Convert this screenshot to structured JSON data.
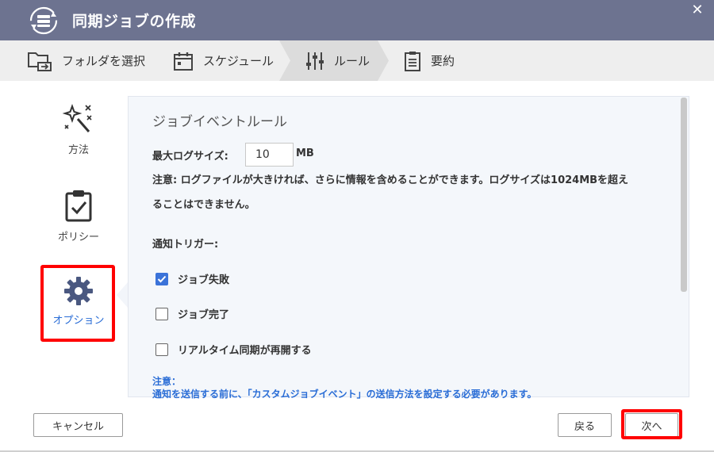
{
  "window": {
    "title": "同期ジョブの作成",
    "close_label": "✕"
  },
  "steps": [
    {
      "label": "フォルダを選択",
      "icon": "folder-sync-icon"
    },
    {
      "label": "スケジュール",
      "icon": "calendar-icon"
    },
    {
      "label": "ルール",
      "icon": "sliders-icon",
      "active": true
    },
    {
      "label": "要約",
      "icon": "clipboard-list-icon"
    }
  ],
  "sidebar": {
    "items": [
      {
        "label": "方法",
        "icon": "magic-wand-icon"
      },
      {
        "label": "ポリシー",
        "icon": "clipboard-check-icon"
      },
      {
        "label": "オプション",
        "icon": "gear-icon",
        "selected": true
      }
    ]
  },
  "main": {
    "section_title": "ジョブイベントルール",
    "log_size_label": "最大ログサイズ:",
    "log_size_value": "10",
    "log_size_unit": "MB",
    "note_line1": "注意: ログファイルが大きければ、さらに情報を含めることができます。ログサイズは1024MBを超え",
    "note_line2": "ることはできません。",
    "trigger_label": "通知トリガー:",
    "triggers": [
      {
        "label": "ジョブ失敗",
        "checked": true
      },
      {
        "label": "ジョブ完了",
        "checked": false
      },
      {
        "label": "リアルタイム同期が再開する",
        "checked": false
      }
    ],
    "notice_title": "注意：",
    "notice_text": "通知を送信する前に、「カスタムジョブイベント」の送信方法を設定する必要があります。"
  },
  "footer": {
    "cancel_label": "キャンセル",
    "back_label": "戻る",
    "next_label": "次へ"
  },
  "colors": {
    "titlebar": "#6d7390",
    "accent_blue": "#2a6dd6",
    "checkbox_blue": "#3b73d9",
    "highlight_red": "#ff0000"
  }
}
